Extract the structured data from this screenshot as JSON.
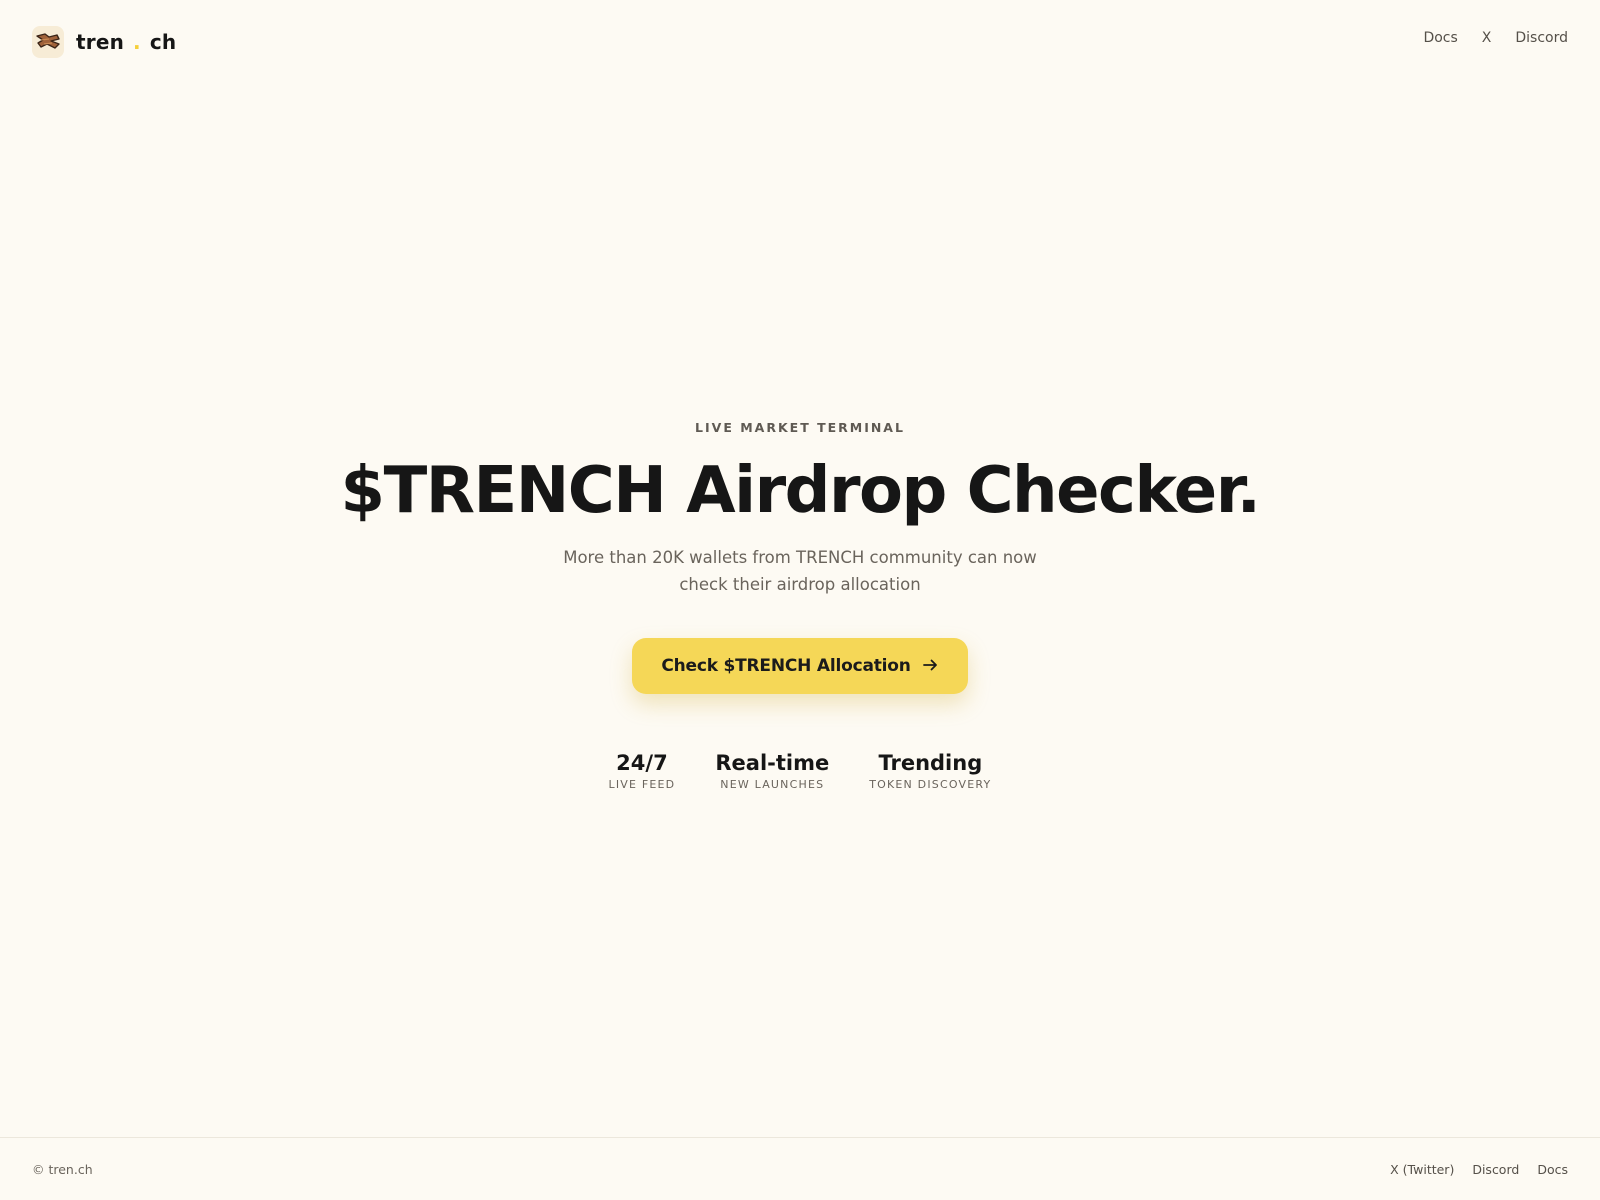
{
  "header": {
    "brand_left": "tren",
    "brand_dot": ".",
    "brand_right": "ch",
    "logo_icon": "trench-logo-icon",
    "nav": [
      "Docs",
      "X",
      "Discord"
    ]
  },
  "hero": {
    "eyebrow": "LIVE MARKET TERMINAL",
    "title": "$TRENCH Airdrop Checker.",
    "subtitle": "More than 20K wallets from TRENCH community can now check their airdrop allocation",
    "cta_label": "Check $TRENCH Allocation",
    "cta_icon": "arrow-right-icon"
  },
  "stats": [
    {
      "value": "24/7",
      "label": "LIVE FEED"
    },
    {
      "value": "Real-time",
      "label": "NEW LAUNCHES"
    },
    {
      "value": "Trending",
      "label": "TOKEN DISCOVERY"
    }
  ],
  "footer": {
    "copyright": "© tren.ch",
    "links": [
      "X (Twitter)",
      "Discord",
      "Docs"
    ]
  },
  "colors": {
    "background": "#fdfaf3",
    "accent": "#f5d757",
    "text": "#161616",
    "muted": "#6a645c"
  }
}
